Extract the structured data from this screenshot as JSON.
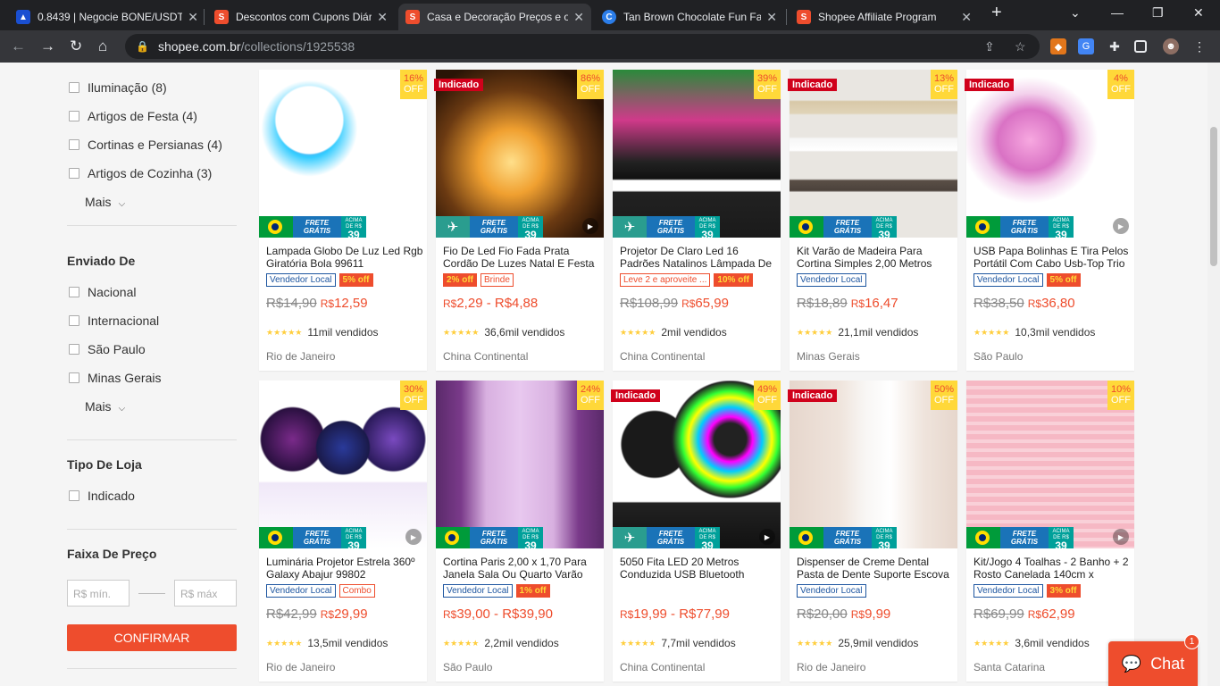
{
  "browser": {
    "tabs": [
      {
        "title": "0.8439 | Negocie BONE/USDT"
      },
      {
        "title": "Descontos com Cupons Diários"
      },
      {
        "title": "Casa e Decoração Preços e ofertas"
      },
      {
        "title": "Tan Brown Chocolate Fun Facts"
      },
      {
        "title": "Shopee Affiliate Program"
      }
    ],
    "url_host": "shopee.com.br",
    "url_path": "/collections/1925538"
  },
  "sidebar": {
    "categories": [
      {
        "label": "Iluminação (8)"
      },
      {
        "label": "Artigos de Festa (4)"
      },
      {
        "label": "Cortinas e Persianas (4)"
      },
      {
        "label": "Artigos de Cozinha (3)"
      }
    ],
    "mais_label": "Mais",
    "enviado_heading": "Enviado De",
    "enviado": [
      {
        "label": "Nacional"
      },
      {
        "label": "Internacional"
      },
      {
        "label": "São Paulo"
      },
      {
        "label": "Minas Gerais"
      }
    ],
    "tipo_heading": "Tipo De Loja",
    "tipo": [
      {
        "label": "Indicado"
      }
    ],
    "faixa_heading": "Faixa De Preço",
    "min_placeholder": "R$ mín.",
    "max_placeholder": "R$ máx",
    "confirm_label": "CONFIRMAR"
  },
  "badges": {
    "indicado": "Indicado",
    "off": "OFF",
    "frete_line1": "FRETE",
    "frete_line2": "GRÁTIS",
    "acima": "ACIMA DE R$",
    "acima_value": "39"
  },
  "products": [
    {
      "name": "Lampada Globo De Luz Led Rgb Giratória Bola 99611",
      "discount": "16%",
      "tags": [
        "Vendedor Local",
        "5% off"
      ],
      "old_price": "R$14,90",
      "price_prefix": "R$",
      "price": "12,59",
      "sold": "11mil vendidos",
      "location": "Rio de Janeiro"
    },
    {
      "name": "Fio De Led Fio Fada Prata Cordão De Luzes Natal E Festa",
      "discount": "86%",
      "tags": [
        "2% off",
        "Brinde"
      ],
      "old_price": "",
      "price_prefix": "R$",
      "price": "2,29 - R$4,88",
      "sold": "36,6mil vendidos",
      "location": "China Continental"
    },
    {
      "name": "Projetor De Claro Led 16 Padrões Natalinos Lâmpada De",
      "discount": "39%",
      "tags": [
        "Leve 2 e aproveite ...",
        "10% off"
      ],
      "old_price": "R$108,99",
      "price_prefix": "R$",
      "price": "65,99",
      "sold": "2mil vendidos",
      "location": "China Continental"
    },
    {
      "name": "Kit Varão de Madeira Para Cortina Simples 2,00 Metros",
      "discount": "13%",
      "tags": [
        "Vendedor Local"
      ],
      "old_price": "R$18,89",
      "price_prefix": "R$",
      "price": "16,47",
      "sold": "21,1mil vendidos",
      "location": "Minas Gerais"
    },
    {
      "name": "USB Papa Bolinhas E Tira Pelos Portátil Com Cabo Usb-Top Trio",
      "discount": "4%",
      "tags": [
        "Vendedor Local",
        "5% off"
      ],
      "old_price": "R$38,50",
      "price_prefix": "R$",
      "price": "36,80",
      "sold": "10,3mil vendidos",
      "location": "São Paulo"
    },
    {
      "name": "Luminária Projetor Estrela 360º Galaxy Abajur 99802",
      "discount": "30%",
      "tags": [
        "Vendedor Local",
        "Combo"
      ],
      "old_price": "R$42,99",
      "price_prefix": "R$",
      "price": "29,99",
      "sold": "13,5mil vendidos",
      "location": "Rio de Janeiro"
    },
    {
      "name": "Cortina Paris 2,00 x 1,70 Para Janela Sala Ou Quarto Varão",
      "discount": "24%",
      "tags": [
        "Vendedor Local",
        "1% off"
      ],
      "old_price": "",
      "price_prefix": "R$",
      "price": "39,00 - R$39,90",
      "sold": "2,2mil vendidos",
      "location": "São Paulo"
    },
    {
      "name": "5050 Fita LED 20 Metros Conduzida USB Bluetooth",
      "discount": "49%",
      "tags": [],
      "old_price": "",
      "price_prefix": "R$",
      "price": "19,99 - R$77,99",
      "sold": "7,7mil vendidos",
      "location": "China Continental"
    },
    {
      "name": "Dispenser de Creme Dental Pasta de Dente Suporte Escova",
      "discount": "50%",
      "tags": [
        "Vendedor Local"
      ],
      "old_price": "R$20,00",
      "price_prefix": "R$",
      "price": "9,99",
      "sold": "25,9mil vendidos",
      "location": "Rio de Janeiro"
    },
    {
      "name": "Kit/Jogo 4 Toalhas - 2 Banho + 2 Rosto Canelada 140cm x",
      "discount": "10%",
      "tags": [
        "Vendedor Local",
        "3% off"
      ],
      "old_price": "R$69,99",
      "price_prefix": "R$",
      "price": "62,99",
      "sold": "3,6mil vendidos",
      "location": "Santa Catarina"
    }
  ],
  "chat": {
    "label": "Chat",
    "badge": "1"
  },
  "colors": {
    "brand": "#ee4d2d",
    "discount_bg": "#ffd839"
  }
}
